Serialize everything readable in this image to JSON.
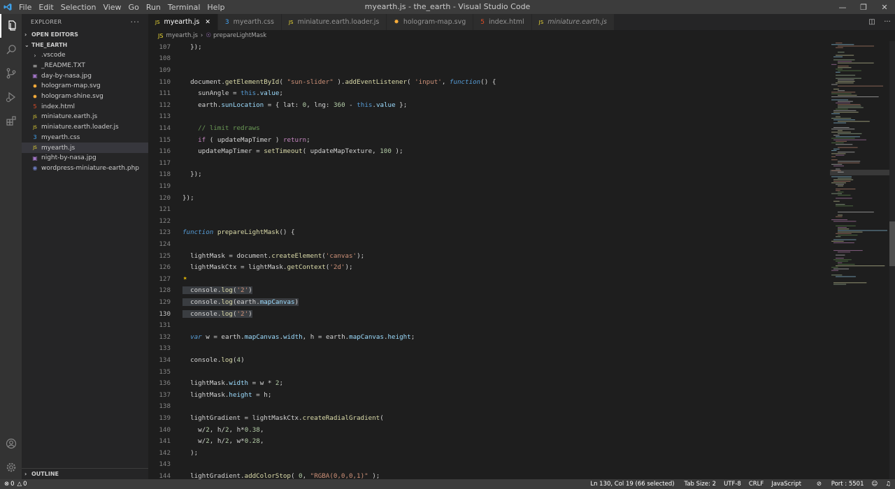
{
  "window": {
    "title": "myearth.js - the_earth - Visual Studio Code",
    "menu": [
      "File",
      "Edit",
      "Selection",
      "View",
      "Go",
      "Run",
      "Terminal",
      "Help"
    ]
  },
  "explorer": {
    "header": "EXPLORER",
    "open_editors": "OPEN EDITORS",
    "folder": "THE_EARTH",
    "outline": "OUTLINE",
    "items": [
      {
        "label": ".vscode",
        "icon": "folder-icon",
        "color": "#c5c5c5"
      },
      {
        "label": "_README.TXT",
        "icon": "lines-icon",
        "color": "#c5c5c5"
      },
      {
        "label": "day-by-nasa.jpg",
        "icon": "image-icon",
        "color": "#a074c4"
      },
      {
        "label": "hologram-map.svg",
        "icon": "svg-icon",
        "color": "#ffb13b"
      },
      {
        "label": "hologram-shine.svg",
        "icon": "svg-icon",
        "color": "#ffb13b"
      },
      {
        "label": "index.html",
        "icon": "html-icon",
        "color": "#e44d26"
      },
      {
        "label": "miniature.earth.js",
        "icon": "js-icon",
        "color": "#f1dd35"
      },
      {
        "label": "miniature.earth.loader.js",
        "icon": "js-icon",
        "color": "#f1dd35"
      },
      {
        "label": "myearth.css",
        "icon": "css-icon",
        "color": "#42a5f5"
      },
      {
        "label": "myearth.js",
        "icon": "js-icon",
        "color": "#f1dd35"
      },
      {
        "label": "night-by-nasa.jpg",
        "icon": "image-icon",
        "color": "#a074c4"
      },
      {
        "label": "wordpress-miniature-earth.php",
        "icon": "php-icon",
        "color": "#6c7bbf"
      }
    ]
  },
  "tabs": [
    {
      "label": "myearth.js",
      "icon": "js-icon",
      "color": "#f1dd35"
    },
    {
      "label": "myearth.css",
      "icon": "css-icon",
      "color": "#42a5f5"
    },
    {
      "label": "miniature.earth.loader.js",
      "icon": "js-icon",
      "color": "#f1dd35"
    },
    {
      "label": "hologram-map.svg",
      "icon": "svg-icon",
      "color": "#ffb13b"
    },
    {
      "label": "index.html",
      "icon": "html-icon",
      "color": "#e44d26"
    },
    {
      "label": "miniature.earth.js",
      "icon": "js-icon",
      "color": "#f1dd35"
    }
  ],
  "breadcrumb": {
    "file": "myearth.js",
    "symbol": "prepareLightMask"
  },
  "code": [
    {
      "n": "107",
      "t": "  });"
    },
    {
      "n": "108",
      "t": ""
    },
    {
      "n": "109",
      "t": ""
    },
    {
      "n": "110",
      "t": "  document.getElementById( \"sun-slider\" ).addEventListener( 'input', function() {"
    },
    {
      "n": "111",
      "t": "    sunAngle = this.value;"
    },
    {
      "n": "112",
      "t": "    earth.sunLocation = { lat: 0, lng: 360 - this.value };"
    },
    {
      "n": "113",
      "t": ""
    },
    {
      "n": "114",
      "t": "    // limit redraws"
    },
    {
      "n": "115",
      "t": "    if ( updateMapTimer ) return;"
    },
    {
      "n": "116",
      "t": "    updateMapTimer = setTimeout( updateMapTexture, 100 );"
    },
    {
      "n": "117",
      "t": ""
    },
    {
      "n": "118",
      "t": "  });"
    },
    {
      "n": "119",
      "t": ""
    },
    {
      "n": "120",
      "t": "});"
    },
    {
      "n": "121",
      "t": ""
    },
    {
      "n": "122",
      "t": ""
    },
    {
      "n": "123",
      "t": "function prepareLightMask() {"
    },
    {
      "n": "124",
      "t": ""
    },
    {
      "n": "125",
      "t": "  lightMask = document.createElement('canvas');"
    },
    {
      "n": "126",
      "t": "  lightMaskCtx = lightMask.getContext('2d');"
    },
    {
      "n": "127",
      "t": ""
    },
    {
      "n": "128",
      "t": "  console.log('2')"
    },
    {
      "n": "129",
      "t": "  console.log(earth.mapCanvas)"
    },
    {
      "n": "130",
      "t": "  console.log('2')"
    },
    {
      "n": "131",
      "t": ""
    },
    {
      "n": "132",
      "t": "  var w = earth.mapCanvas.width, h = earth.mapCanvas.height;"
    },
    {
      "n": "133",
      "t": ""
    },
    {
      "n": "134",
      "t": "  console.log(4)"
    },
    {
      "n": "135",
      "t": ""
    },
    {
      "n": "136",
      "t": "  lightMask.width = w * 2;"
    },
    {
      "n": "137",
      "t": "  lightMask.height = h;"
    },
    {
      "n": "138",
      "t": ""
    },
    {
      "n": "139",
      "t": "  lightGradient = lightMaskCtx.createRadialGradient("
    },
    {
      "n": "140",
      "t": "    w/2, h/2, h*0.38,"
    },
    {
      "n": "141",
      "t": "    w/2, h/2, w*0.28,"
    },
    {
      "n": "142",
      "t": "  );"
    },
    {
      "n": "143",
      "t": ""
    },
    {
      "n": "144",
      "t": "  lightGradient.addColorStop( 0, \"RGBA(0,0,0,1)\" );"
    }
  ],
  "status": {
    "errors": "0",
    "warnings": "0",
    "position": "Ln 130, Col 19 (66 selected)",
    "tab_size": "Tab Size: 2",
    "encoding": "UTF-8",
    "eol": "CRLF",
    "language": "JavaScript",
    "port": "Port : 5501"
  }
}
